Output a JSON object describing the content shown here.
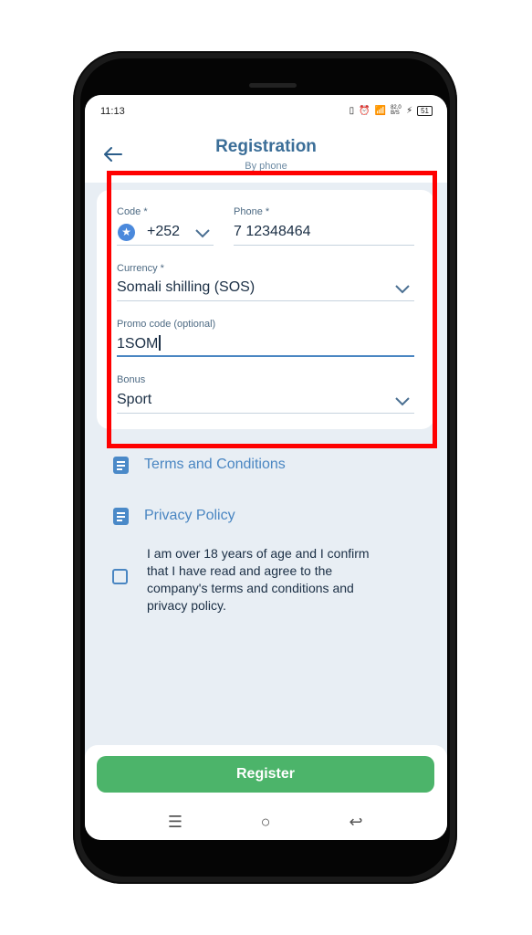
{
  "status": {
    "time": "11:13",
    "network_speed": "82.0\nB/S",
    "battery": "51"
  },
  "header": {
    "title": "Registration",
    "subtitle": "By phone"
  },
  "form": {
    "code_label": "Code *",
    "code_value": "+252",
    "phone_label": "Phone *",
    "phone_value": "7 12348464",
    "currency_label": "Currency *",
    "currency_value": "Somali shilling (SOS)",
    "promo_label": "Promo code (optional)",
    "promo_value": "1SOM",
    "bonus_label": "Bonus",
    "bonus_value": "Sport"
  },
  "links": {
    "terms": "Terms and Conditions",
    "privacy": "Privacy Policy"
  },
  "consent": {
    "text": "I am over 18 years of age and I confirm that I have read and agree to the company's terms and conditions and privacy policy.",
    "checked": false
  },
  "actions": {
    "register_label": "Register"
  },
  "colors": {
    "accent": "#4a86c2",
    "register": "#4cb46a",
    "highlight": "#ff0000",
    "title": "#3b6e98"
  }
}
